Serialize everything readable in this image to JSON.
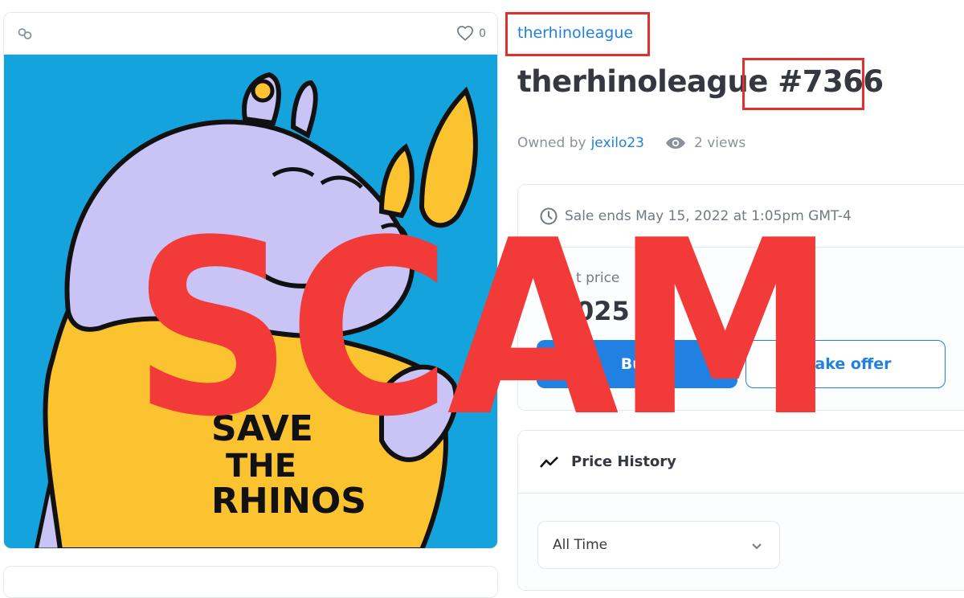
{
  "media": {
    "favorite_count": "0",
    "artwork_text": [
      "SAVE",
      "THE",
      "RHINOS"
    ]
  },
  "item": {
    "collection": "therhinoleague",
    "title": "therhinoleague #7366",
    "owned_by_label": "Owned by",
    "owner": "jexilo23",
    "views": "2 views"
  },
  "sale": {
    "ends_text": "Sale ends May 15, 2022 at 1:05pm GMT-4",
    "price_label": "t price",
    "price_value": "025",
    "buy_label": "Buy",
    "offer_label": "Make offer"
  },
  "price_history": {
    "title": "Price History",
    "range_selected": "All Time"
  },
  "overlay": {
    "text": "SCAM",
    "color": "#f23b39"
  },
  "colors": {
    "accent": "#2081e2",
    "highlight_box": "#e0312c",
    "artwork_background": "#14a3dc"
  }
}
